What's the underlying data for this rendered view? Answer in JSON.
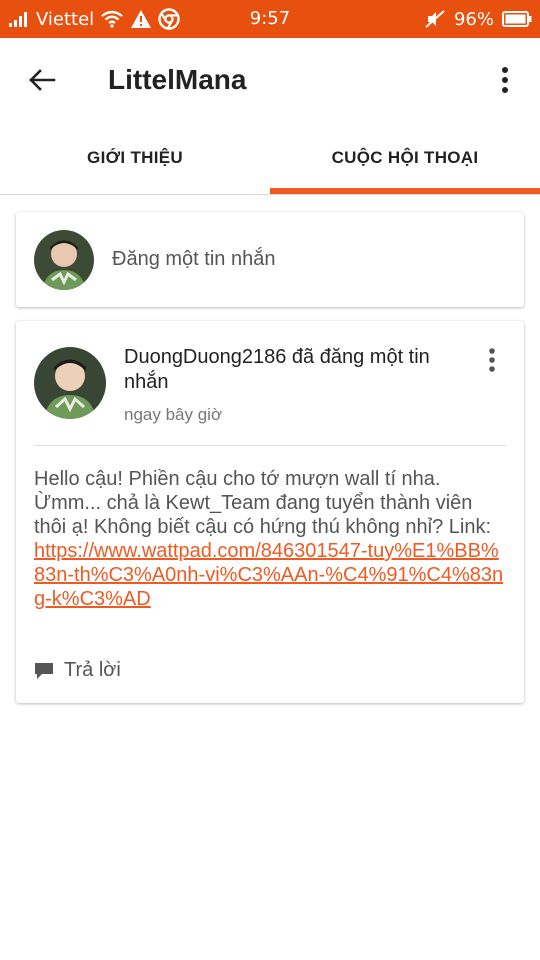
{
  "status_bar": {
    "carrier": "Viettel",
    "time": "9:57",
    "battery": "96%"
  },
  "toolbar": {
    "title": "LittelMana"
  },
  "tabs": [
    {
      "label": "GIỚI THIỆU",
      "active": false
    },
    {
      "label": "CUỘC HỘI THOẠI",
      "active": true
    }
  ],
  "compose": {
    "placeholder": "Đăng một tin nhắn"
  },
  "post": {
    "username": "DuongDuong2186",
    "action": " đã đăng một tin nhắn",
    "time": "ngay bây giờ",
    "body_text": "Hello cậu! Phiền cậu cho tớ mượn wall tí nha. Ừmm... chả là Kewt_Team đang tuyển thành viên thôi ạ! Không biết cậu có hứng thú không nhỉ? Link: ",
    "link": "https://www.wattpad.com/846301547-tuy%E1%BB%83n-th%C3%A0nh-vi%C3%AAn-%C4%91%C4%83ng-k%C3%AD",
    "reply_label": "Trả lời"
  },
  "colors": {
    "status_bar": "#e8500f",
    "accent": "#f05a22"
  }
}
